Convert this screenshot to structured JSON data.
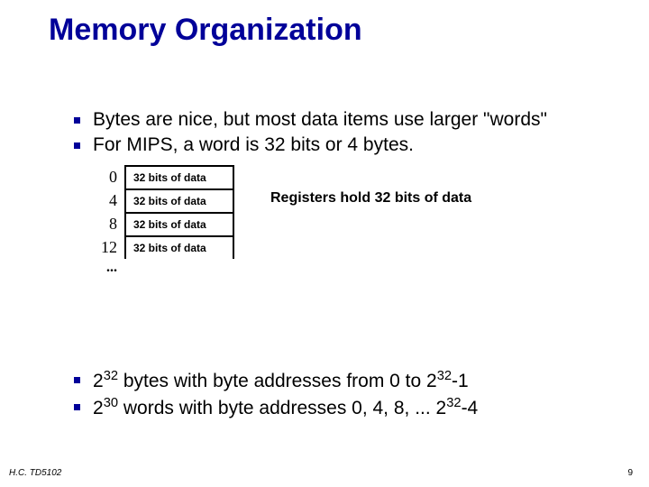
{
  "title": "Memory Organization",
  "bullets_top": [
    "Bytes are nice, but most data items use larger \"words\"",
    "For MIPS, a word is 32 bits or 4 bytes."
  ],
  "diagram": {
    "rows": [
      {
        "addr": "0",
        "text": "32 bits of data"
      },
      {
        "addr": "4",
        "text": "32 bits of data"
      },
      {
        "addr": "8",
        "text": "32 bits of data"
      },
      {
        "addr": "12",
        "text": "32 bits of data"
      }
    ],
    "dots": "..."
  },
  "register_note": "Registers hold 32 bits of data",
  "bullets_bottom_html": [
    "2<sup>32</sup> bytes with byte addresses from 0 to 2<sup>32</sup>-1",
    "2<sup>30</sup> words with byte addresses 0, 4, 8, ... 2<sup>32</sup>-4"
  ],
  "footer_left": "H.C. TD5102",
  "footer_right": "9"
}
